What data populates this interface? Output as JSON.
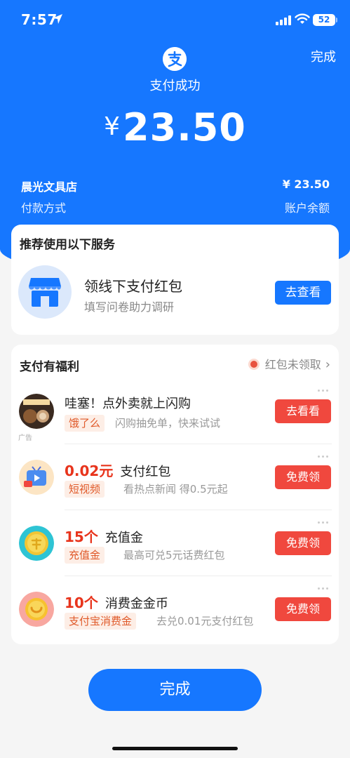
{
  "status_bar": {
    "time": "7:57",
    "battery": "52"
  },
  "header": {
    "done_label": "完成",
    "status": "支付成功",
    "currency": "¥",
    "amount": "23.50",
    "merchant": "晨光文具店",
    "merchant_amount": "¥ 23.50",
    "payment_method_label": "付款方式",
    "payment_method_value": "账户余额"
  },
  "recommend": {
    "title": "推荐使用以下服务",
    "service_title": "领线下支付红包",
    "service_subtitle": "填写问卷助力调研",
    "button": "去查看"
  },
  "benefits": {
    "title": "支付有福利",
    "unclaimed_label": "红包未领取",
    "items": [
      {
        "highlight": "",
        "title": "哇塞！点外卖就上闪购",
        "tag": "饿了么",
        "desc": "闪购抽免单，快来试试",
        "button": "去看看",
        "ad": "广告",
        "icon": "food-ad-icon"
      },
      {
        "highlight": "0.02元",
        "title": "支付红包",
        "tag": "短视频",
        "desc": "看热点新闻 得0.5元起",
        "button": "免费领",
        "icon": "tv-icon"
      },
      {
        "highlight": "15个",
        "title": "充值金",
        "tag": "充值金",
        "desc": "最高可兑5元话费红包",
        "button": "免费领",
        "icon": "coin-icon"
      },
      {
        "highlight": "10个",
        "title": "消费金金币",
        "tag": "支付宝消费金",
        "desc": "去兑0.01元支付红包",
        "button": "免费领",
        "icon": "smile-coin-icon"
      }
    ]
  },
  "footer": {
    "done_label": "完成"
  },
  "colors": {
    "primary": "#1677ff",
    "danger": "#f0483e",
    "highlight": "#e8341c"
  }
}
